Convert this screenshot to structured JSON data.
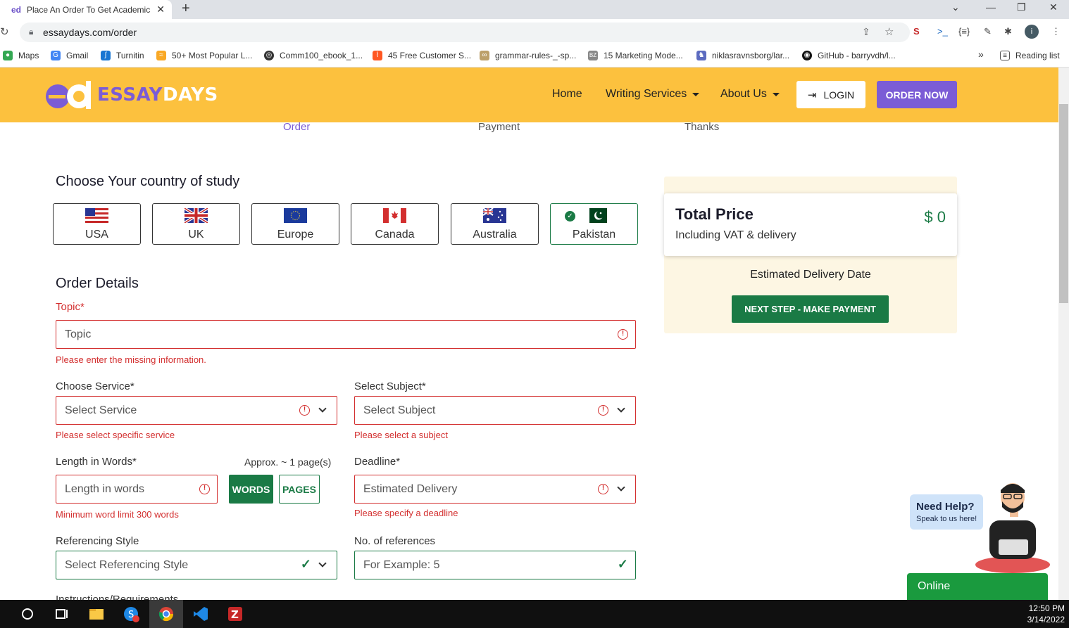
{
  "browser": {
    "tab_title": "Place An Order To Get Academic",
    "url": "essaydays.com/order",
    "bookmarks": [
      "Maps",
      "Gmail",
      "Turnitin",
      "50+ Most Popular L...",
      "Comm100_ebook_1...",
      "45 Free Customer S...",
      "grammar-rules-_-sp...",
      "15 Marketing Mode...",
      "niklasravnsborg/lar...",
      "GitHub - barryvdh/l..."
    ],
    "more_bookmarks": "»",
    "reading_list": "Reading list"
  },
  "header": {
    "logo_part1": "ESSAY",
    "logo_part2": "DAYS",
    "nav": [
      "Home",
      "Writing Services",
      "About Us"
    ],
    "login_label": "LOGIN",
    "order_now_label": "ORDER NOW"
  },
  "steps": [
    "Order",
    "Payment",
    "Thanks"
  ],
  "country_section": {
    "title": "Choose Your country of study",
    "countries": [
      "USA",
      "UK",
      "Europe",
      "Canada",
      "Australia",
      "Pakistan"
    ],
    "selected": "Pakistan"
  },
  "order_details": {
    "title": "Order Details",
    "topic": {
      "label": "Topic*",
      "placeholder": "Topic",
      "error": "Please enter the missing information."
    },
    "service": {
      "label": "Choose Service*",
      "placeholder": "Select Service",
      "error": "Please select specific service"
    },
    "subject": {
      "label": "Select Subject*",
      "placeholder": "Select Subject",
      "error": "Please select a subject"
    },
    "length": {
      "label": "Length in Words*",
      "approx": "Approx. ~ 1 page(s)",
      "placeholder": "Length in words",
      "error": "Minimum word limit 300 words",
      "words_btn": "WORDS",
      "pages_btn": "PAGES"
    },
    "deadline": {
      "label": "Deadline*",
      "placeholder": "Estimated Delivery",
      "error": "Please specify a deadline"
    },
    "referencing": {
      "label": "Referencing Style",
      "placeholder": "Select Referencing Style"
    },
    "references": {
      "label": "No. of references",
      "placeholder": "For Example: 5"
    },
    "instructions_label": "Instructions/Requirements"
  },
  "sidebar": {
    "total_label": "Total Price",
    "total_sub": "Including VAT & delivery",
    "total_value": "$ 0",
    "delivery_label": "Estimated Delivery Date",
    "next_label": "NEXT STEP - MAKE PAYMENT"
  },
  "chat": {
    "need_help": "Need Help?",
    "speak": "Speak to us here!",
    "status": "Online"
  },
  "taskbar": {
    "time": "12:50 PM",
    "date": "3/14/2022"
  },
  "colors": {
    "header_bg": "#fcc13e",
    "brand_purple": "#7b5cd6",
    "success_green": "#1a7a45",
    "error_red": "#d32f2f"
  }
}
